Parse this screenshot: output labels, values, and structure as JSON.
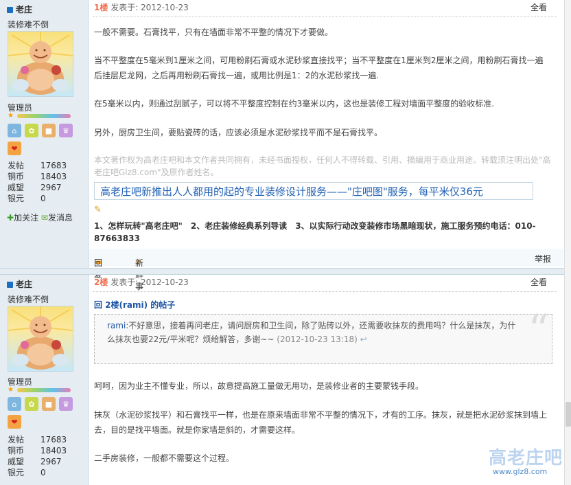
{
  "user": {
    "name": "老庄",
    "tagline": "装修难不倒",
    "role": "管理员",
    "stats": [
      {
        "k": "发帖",
        "v": "17683"
      },
      {
        "k": "铜币",
        "v": "18403"
      },
      {
        "k": "威望",
        "v": "2967"
      },
      {
        "k": "银元",
        "v": "0"
      }
    ],
    "add_follow": "加关注",
    "send_msg": "发消息"
  },
  "post1": {
    "floor": "1楼",
    "posted_at": "发表于: 2012-10-23",
    "view_all": "全看",
    "paragraphs": [
      "一般不需要。石膏找平，只有在墙面非常不平整的情况下才要做。",
      "当不平整度在5毫米到1厘米之间，可用粉刷石膏或水泥砂浆直接找平；当不平整度在1厘米到2厘米之间，用粉刷石膏找一遍后挂层尼龙网，之后再用粉刷石膏找一遍，或用比例是1：2的水泥砂浆找一遍.",
      "在5毫米以内，则通过刮腻子，可以将不平整度控制在约3毫米以内，这也是装修工程对墙面平整度的验收标准.",
      "另外，厨房卫生间，要贴瓷砖的话，应该必须是水泥砂浆找平而不是石膏找平。"
    ],
    "copyright": "本文著作权为高老庄吧和本文作者共同拥有，未经书面授权，任何人不得转载、引用、摘编用于商业用途。转载须注明出处\"高老庄吧Glz8.com\"及原作者姓名。",
    "promo": "高老庄吧新推出人人都用的起的专业装修设计服务——\"庄吧图\"服务，每平米仅36元",
    "links": "1、怎样玩转\"高老庄吧\"　2、老庄装修经典系列导读　3、以实际行动改变装修市场黑暗现状，施工服务预约电话：010-87663833",
    "reply": "回复",
    "news": "新鲜事",
    "report": "举报"
  },
  "post2": {
    "floor": "2楼",
    "posted_at": "发表于: 2012-10-23",
    "view_all": "全看",
    "reply_to": "回 2楼(rami) 的帖子",
    "quote_user": "rami",
    "quote_text": ":不好意思，接着再问老庄，请问厨房和卫生间，除了贴砖以外，还需要收抹灰的费用吗？什么是抹灰，为什么抹灰也要22元/平米呢？烦给解答，多谢~~",
    "quote_time": "(2012-10-23 13:18)",
    "paragraphs": [
      "呵呵，因为业主不懂专业，所以，故意提高施工量做无用功，是装修业者的主要蒙钱手段。",
      "抹灰（水泥砂浆找平）和石膏找平一样，也是在原来墙面非常不平整的情况下，才有的工序。抹灰，就是把水泥砂浆抹到墙上去，目的是找平墙面。就是你家墙是斜的，才需要这样。",
      "二手房装修，一般都不需要这个过程。"
    ]
  },
  "watermark": {
    "logo": "高老庄吧",
    "url": "www.glz8.com"
  }
}
